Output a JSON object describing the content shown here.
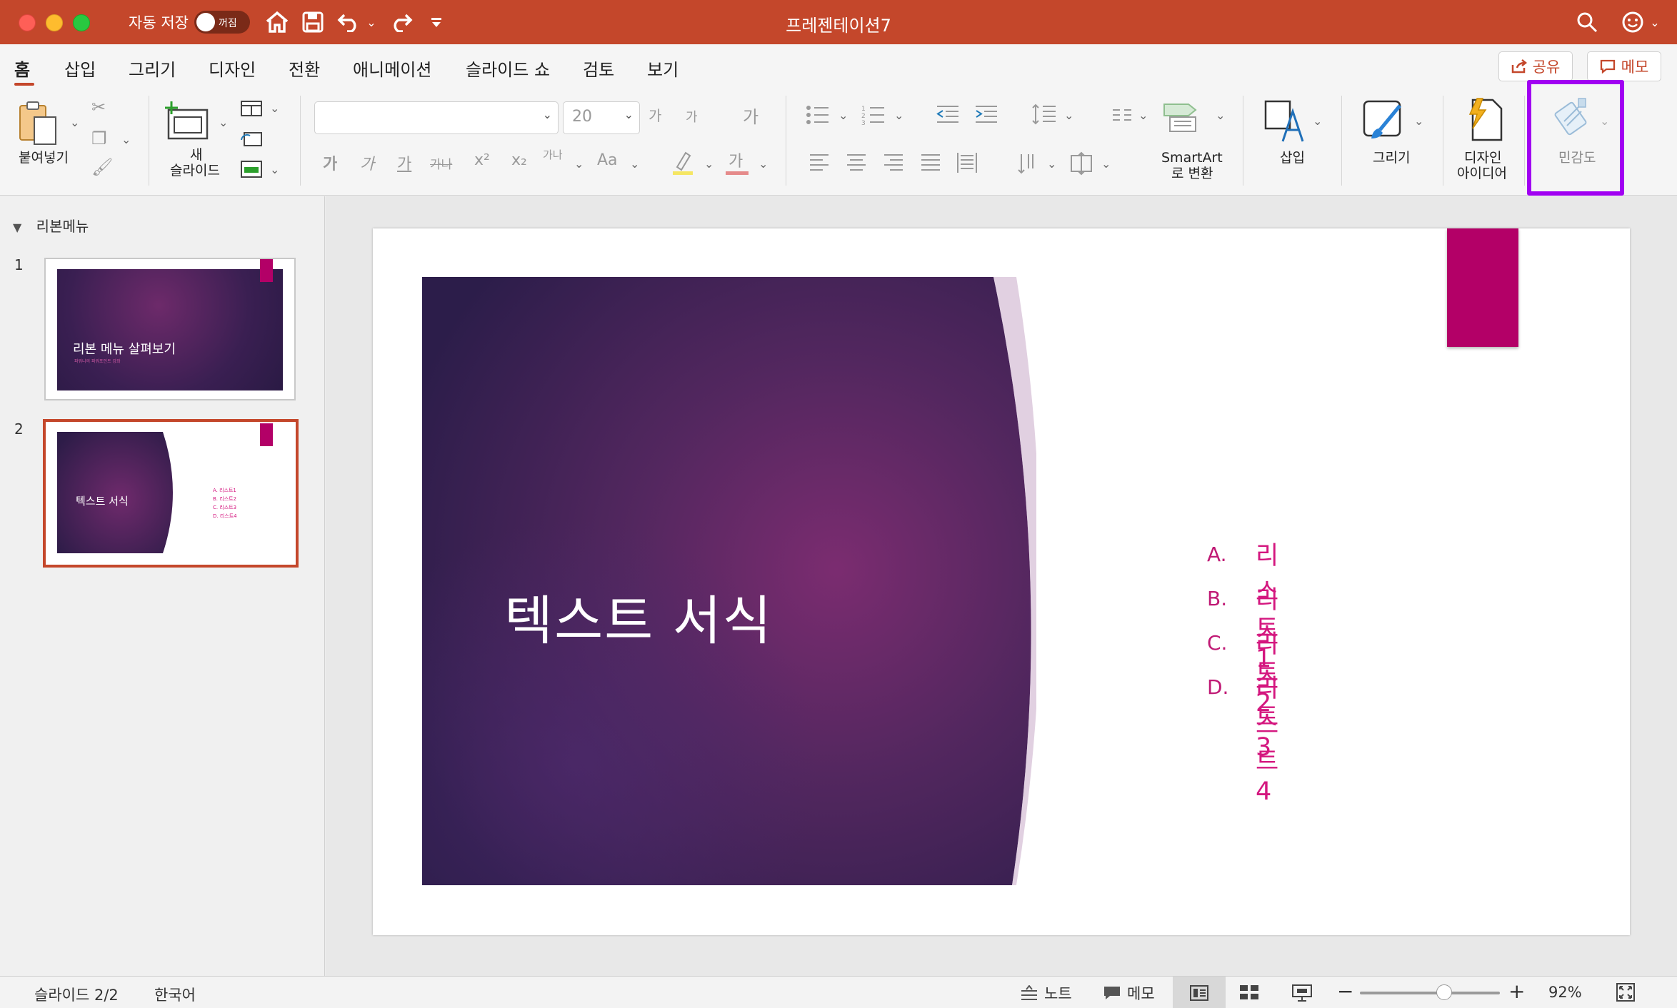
{
  "titlebar": {
    "autosave_label": "자동 저장",
    "autosave_state": "꺼짐",
    "document_title": "프레젠테이션7"
  },
  "tabs": [
    {
      "label": "홈",
      "active": true
    },
    {
      "label": "삽입"
    },
    {
      "label": "그리기"
    },
    {
      "label": "디자인"
    },
    {
      "label": "전환"
    },
    {
      "label": "애니메이션"
    },
    {
      "label": "슬라이드 쇼"
    },
    {
      "label": "검토"
    },
    {
      "label": "보기"
    }
  ],
  "actions": {
    "share": "공유",
    "memo": "메모"
  },
  "ribbon": {
    "paste": "붙여넣기",
    "new_slide_1": "새",
    "new_slide_2": "슬라이드",
    "font_name": "",
    "font_size": "20",
    "smartart_1": "SmartArt",
    "smartart_2": "로 변환",
    "insert": "삽입",
    "draw": "그리기",
    "design_ideas_1": "디자인",
    "design_ideas_2": "아이디어",
    "sensitivity": "민감도",
    "format_glyphs": {
      "bold": "가",
      "italic": "가",
      "underline": "가",
      "strike": "가나",
      "superscript": "x²",
      "subscript": "x₂",
      "char_spacing": "가나",
      "change_case": "Aa",
      "font_color": "가",
      "grow": "가",
      "shrink": "가",
      "clear": "가"
    }
  },
  "outline": {
    "header": "리본메뉴",
    "slides": [
      {
        "num": "1",
        "title": "리본 메뉴 살펴보기",
        "subtitle": "파워니의 파워포인트 강좌"
      },
      {
        "num": "2",
        "title": "텍스트 서식",
        "items": [
          "A.  리스트1",
          "B.  리스트2",
          "C.  리스트3",
          "D.  리스트4"
        ]
      }
    ]
  },
  "slide": {
    "title": "텍스트 서식",
    "list": [
      {
        "marker": "A.",
        "text": "리스트1"
      },
      {
        "marker": "B.",
        "text": "리스트2"
      },
      {
        "marker": "C.",
        "text": "리스트3"
      },
      {
        "marker": "D.",
        "text": "리스트4"
      }
    ]
  },
  "status": {
    "slide_indicator": "슬라이드 2/2",
    "language": "한국어",
    "notes": "노트",
    "comments": "메모",
    "zoom": "92%",
    "zoom_level": 0.6
  },
  "colors": {
    "brand": "#c4472b",
    "accent_magenta": "#b30067",
    "list_pink": "#d4177f",
    "highlight_purple": "#a100f2"
  }
}
